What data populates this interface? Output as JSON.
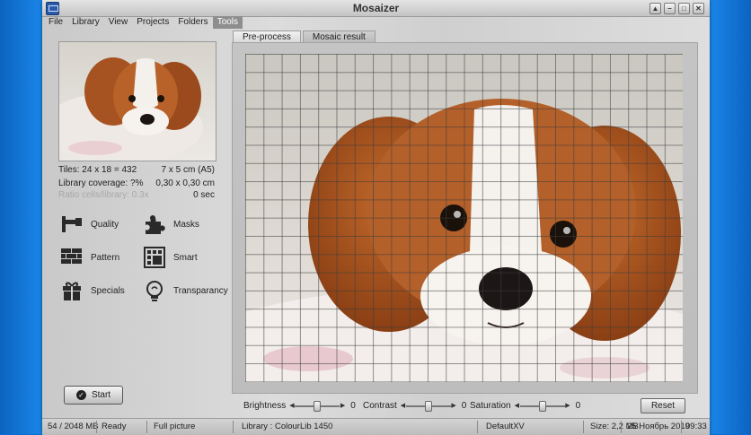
{
  "window": {
    "title": "Mosaizer"
  },
  "window_buttons": [
    "▲",
    "–",
    "□",
    "✕"
  ],
  "menu": [
    "File",
    "Library",
    "View",
    "Projects",
    "Folders",
    "Tools"
  ],
  "info": {
    "tiles": "Tiles: 24 x 18 = 432",
    "size": "7 x 5 cm  (A5)",
    "coverage": "Library coverage: ?%",
    "tile_size": "0,30 x 0,30 cm",
    "ratio": "Ratio cells/library: 0.3x",
    "time": "0 sec"
  },
  "tools": [
    {
      "label": "Quality",
      "icon": "quality-icon"
    },
    {
      "label": "Masks",
      "icon": "puzzle-icon"
    },
    {
      "label": "Pattern",
      "icon": "brick-icon"
    },
    {
      "label": "Smart",
      "icon": "grid-icon"
    },
    {
      "label": "Specials",
      "icon": "gift-icon"
    },
    {
      "label": "Transparancy",
      "icon": "bulb-icon"
    }
  ],
  "start_label": "Start",
  "tabs": [
    "Pre-process",
    "Mosaic result"
  ],
  "active_tab": 0,
  "controls": {
    "brightness": {
      "label": "Brightness",
      "value": "0",
      "level": 0.5
    },
    "contrast": {
      "label": "Contrast",
      "value": "0",
      "level": 0.5
    },
    "saturation": {
      "label": "Saturation",
      "value": "0",
      "level": 0.5
    },
    "reset_label": "Reset"
  },
  "status": {
    "memory": "54 / 2048 MB",
    "state": "Ready",
    "mode": "Full picture",
    "library": "Library : ColourLib 1450",
    "preset": "DefaultXV",
    "size": "Size: 2,2 MB",
    "date": "25 Ноябрь 2019",
    "time": "09:33"
  },
  "colors": {
    "accent": "#8e8e8e",
    "desktop": "#1f8cf0"
  }
}
